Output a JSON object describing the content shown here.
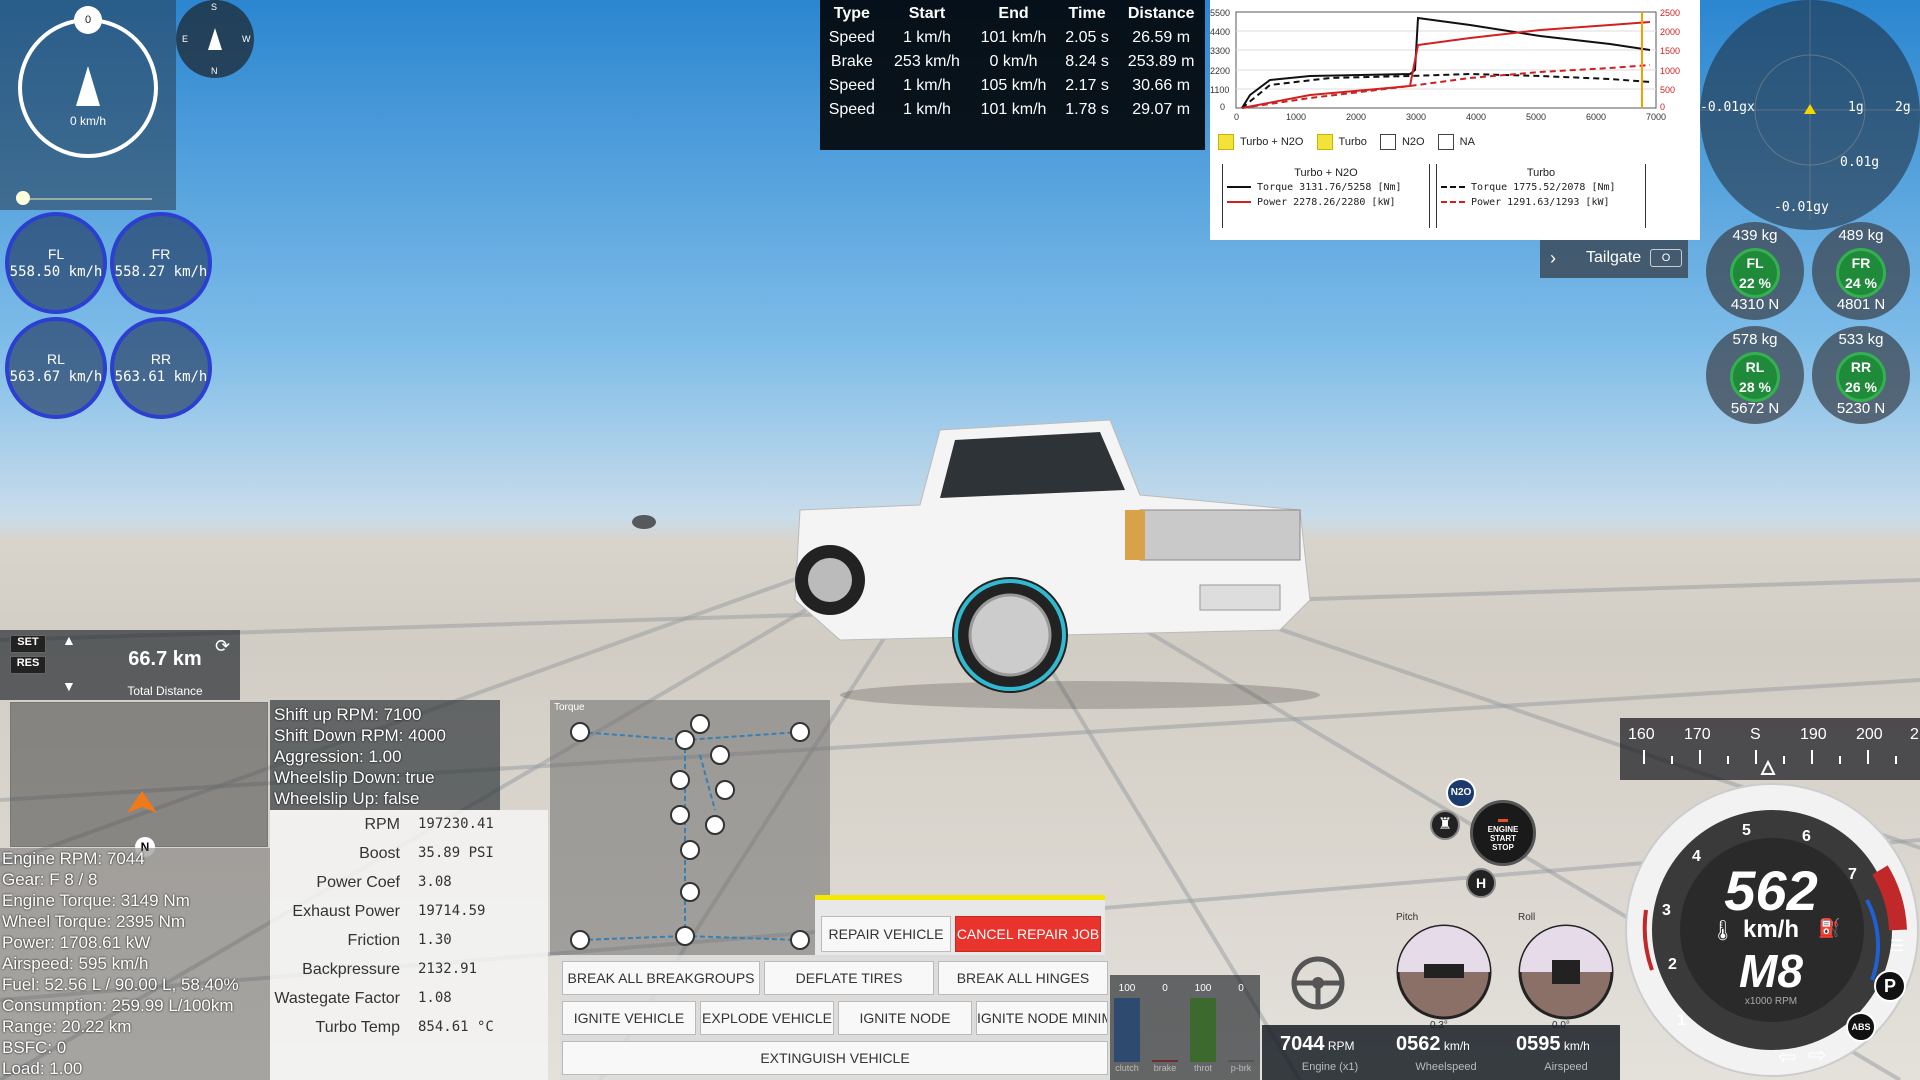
{
  "compass": {
    "heading_knob": "0",
    "speed": "0 km/h",
    "mini_labels": [
      "S",
      "E",
      "W",
      "N"
    ]
  },
  "wheels": [
    {
      "name": "FL",
      "value": "558.50 km/h"
    },
    {
      "name": "FR",
      "value": "558.27 km/h"
    },
    {
      "name": "RL",
      "value": "563.67 km/h"
    },
    {
      "name": "RR",
      "value": "563.61 km/h"
    }
  ],
  "drag_table": {
    "headers": [
      "Type",
      "Start",
      "End",
      "Time",
      "Distance"
    ],
    "rows": [
      [
        "Speed",
        "1 km/h",
        "101 km/h",
        "2.05 s",
        "26.59 m"
      ],
      [
        "Brake",
        "253 km/h",
        "0 km/h",
        "8.24 s",
        "253.89 m"
      ],
      [
        "Speed",
        "1 km/h",
        "105 km/h",
        "2.17 s",
        "30.66 m"
      ],
      [
        "Speed",
        "1 km/h",
        "101 km/h",
        "1.78 s",
        "29.07 m"
      ]
    ]
  },
  "dyno": {
    "y_left_ticks": [
      "5500",
      "4400",
      "3300",
      "2200",
      "1100",
      "0"
    ],
    "y_right_ticks": [
      "2500",
      "2000",
      "1500",
      "1000",
      "500",
      "0"
    ],
    "x_ticks": [
      "0",
      "1000",
      "2000",
      "3000",
      "4000",
      "5000",
      "6000",
      "7000"
    ],
    "toggles": [
      {
        "label": "Turbo + N2O",
        "checked": true
      },
      {
        "label": "Turbo",
        "checked": true
      },
      {
        "label": "N2O",
        "checked": false
      },
      {
        "label": "NA",
        "checked": false
      }
    ],
    "legend_a_title": "Turbo + N2O",
    "legend_a_torque": "Torque 3131.76/5258 [Nm]",
    "legend_a_power": "Power  2278.26/2280 [kW]",
    "legend_b_title": "Turbo",
    "legend_b_torque": "Torque 1775.52/2078 [Nm]",
    "legend_b_power": "Power  1291.63/1293 [kW]"
  },
  "gmeter": {
    "left": "-0.01gx",
    "top_right": "1g",
    "far_right": "2g",
    "right": "0.01g",
    "bottom": "-0.01gy"
  },
  "tailgate": {
    "label": "Tailgate",
    "key": "O"
  },
  "tire_loads": [
    {
      "mass": "439 kg",
      "name": "FL",
      "pct": "22 %",
      "force": "4310 N"
    },
    {
      "mass": "489 kg",
      "name": "FR",
      "pct": "24 %",
      "force": "4801 N"
    },
    {
      "mass": "578 kg",
      "name": "RL",
      "pct": "28 %",
      "force": "5672 N"
    },
    {
      "mass": "533 kg",
      "name": "RR",
      "pct": "26 %",
      "force": "5230 N"
    }
  ],
  "cruise": {
    "set": "SET",
    "res": "RES",
    "distance": "66.7 km",
    "distance_label": "Total Distance"
  },
  "minimap": {
    "marker": "N"
  },
  "gearbox": {
    "lines": [
      "Shift up RPM: 7100",
      "Shift Down RPM: 4000",
      "Aggression: 1.00",
      "Wheelslip Down: true",
      "Wheelslip Up: false"
    ]
  },
  "vehicle_info": [
    "Engine RPM: 7044",
    "Gear: F 8 / 8",
    "Engine Torque: 3149 Nm",
    "Wheel Torque: 2395 Nm",
    "Power: 1708.61 kW",
    "Airspeed: 595 km/h",
    "Fuel: 52.56 L / 90.00 L, 58.40%",
    "Consumption: 259.99 L/100km",
    "Range: 20.22 km",
    "BSFC: 0",
    "Load: 1.00"
  ],
  "engine_table": [
    {
      "k": "RPM",
      "v": "197230.41"
    },
    {
      "k": "Boost",
      "v": "35.89 PSI"
    },
    {
      "k": "Power Coef",
      "v": "3.08"
    },
    {
      "k": "Exhaust Power",
      "v": "19714.59"
    },
    {
      "k": "Friction",
      "v": "1.30"
    },
    {
      "k": "Backpressure",
      "v": "2132.91"
    },
    {
      "k": "Wastegate Factor",
      "v": "1.08"
    },
    {
      "k": "Turbo Temp",
      "v": "854.61 °C"
    }
  ],
  "powertrain": {
    "title": "Torque"
  },
  "repair": {
    "repair": "REPAIR VEHICLE",
    "cancel": "CANCEL REPAIR JOB"
  },
  "actions": {
    "break_groups": "BREAK ALL BREAKGROUPS",
    "deflate": "DEFLATE TIRES",
    "break_hinges": "BREAK ALL HINGES",
    "ignite_vehicle": "IGNITE VEHICLE",
    "explode": "EXPLODE VEHICLE",
    "ignite_node": "IGNITE NODE",
    "ignite_node_min": "IGNITE NODE MINIM",
    "extinguish": "EXTINGUISH VEHICLE"
  },
  "pedals": [
    {
      "value": "100",
      "label": "clutch",
      "level": 1.0,
      "color": "#2e4a6e"
    },
    {
      "value": "0",
      "label": "brake",
      "level": 0.0,
      "color": "#6e2e2e"
    },
    {
      "value": "100",
      "label": "throt",
      "level": 1.0,
      "color": "#3c6a2e"
    },
    {
      "value": "0",
      "label": "p-brk",
      "level": 0.0,
      "color": "#555555"
    }
  ],
  "attitude": {
    "pitch_label": "Pitch",
    "pitch_value": "0.3°",
    "roll_label": "Roll",
    "roll_value": "0.0°"
  },
  "readouts": {
    "rpm": "7044",
    "rpm_unit": "RPM",
    "rpm_label": "Engine (x1)",
    "wheel": "0562",
    "wheel_unit": "km/h",
    "wheel_label": "Wheelspeed",
    "air": "0595",
    "air_unit": "km/h",
    "air_label": "Airspeed"
  },
  "heading_tape": {
    "ticks": [
      "160",
      "170",
      "S",
      "190",
      "200",
      "2"
    ]
  },
  "engine_button": {
    "line1": "ENGINE",
    "line2": "START",
    "line3": "STOP"
  },
  "nitrous": "N2O",
  "speedo": {
    "speed": "562",
    "unit": "km/h",
    "gear": "M8",
    "rpm_label": "x1000 RPM",
    "ticks": [
      "1",
      "2",
      "3",
      "4",
      "5",
      "6",
      "7"
    ],
    "p_label": "P",
    "abs_label": "ABS"
  }
}
